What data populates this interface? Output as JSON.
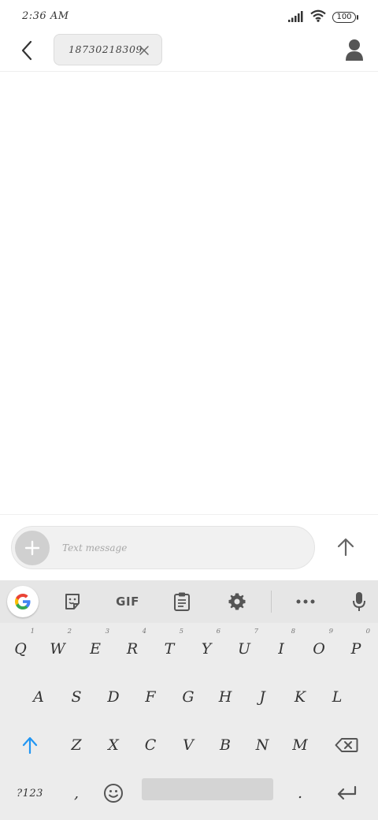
{
  "status_bar": {
    "time": "2:36 AM",
    "battery": "100"
  },
  "header": {
    "recipient": "18730218309"
  },
  "compose": {
    "placeholder": "Text message"
  },
  "keyboard": {
    "toolbar": {
      "gif_label": "GIF"
    },
    "row1": [
      {
        "key": "Q",
        "hint": "1"
      },
      {
        "key": "W",
        "hint": "2"
      },
      {
        "key": "E",
        "hint": "3"
      },
      {
        "key": "R",
        "hint": "4"
      },
      {
        "key": "T",
        "hint": "5"
      },
      {
        "key": "Y",
        "hint": "6"
      },
      {
        "key": "U",
        "hint": "7"
      },
      {
        "key": "I",
        "hint": "8"
      },
      {
        "key": "O",
        "hint": "9"
      },
      {
        "key": "P",
        "hint": "0"
      }
    ],
    "row2": [
      "A",
      "S",
      "D",
      "F",
      "G",
      "H",
      "J",
      "K",
      "L"
    ],
    "row3": [
      "Z",
      "X",
      "C",
      "V",
      "B",
      "N",
      "M"
    ],
    "bottom": {
      "symbols": "?123",
      "comma": ",",
      "period": "."
    }
  },
  "colors": {
    "accent": "#2196f3",
    "keyboard_bg": "#ececec",
    "toolbar_bg": "#e6e6e6"
  }
}
